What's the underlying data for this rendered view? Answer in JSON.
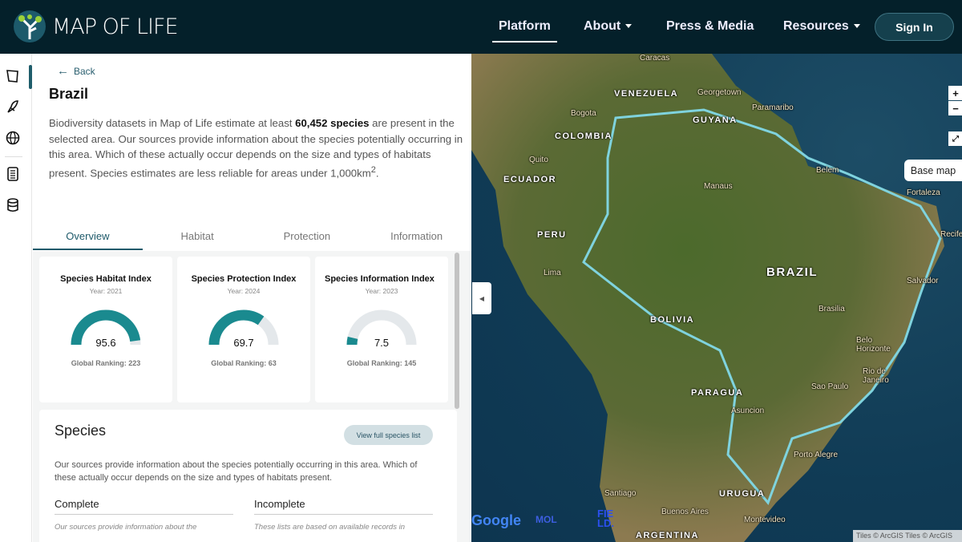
{
  "header": {
    "brand": "MAP OF LIFE",
    "nav": [
      "Platform",
      "About",
      "Press & Media",
      "Resources"
    ],
    "sign_in": "Sign In"
  },
  "panel": {
    "back": "Back",
    "title": "Brazil",
    "desc_1": "Biodiversity datasets in Map of Life estimate at least ",
    "desc_bold": "60,452 species",
    "desc_2": " are present in the selected area. Our sources provide information about the species potentially occurring in this area. Which of these actually occur depends on the size and types of habitats present. Species estimates are less reliable for areas under 1,000km",
    "desc_sup": "2",
    "desc_end": ".",
    "tabs": [
      "Overview",
      "Habitat",
      "Protection",
      "Information"
    ],
    "cards": [
      {
        "title": "Species Habitat Index",
        "year": "Year: 2021",
        "value": 95.6,
        "value_text": "95.6",
        "ranking": "Global Ranking: 223"
      },
      {
        "title": "Species Protection Index",
        "year": "Year: 2024",
        "value": 69.7,
        "value_text": "69.7",
        "ranking": "Global Ranking: 63"
      },
      {
        "title": "Species Information Index",
        "year": "Year: 2023",
        "value": 7.5,
        "value_text": "7.5",
        "ranking": "Global Ranking: 145"
      }
    ],
    "species": {
      "title": "Species",
      "button": "View full species list",
      "desc": "Our sources provide information about the species potentially occurring in this area. Which of these actually occur depends on the size and types of habitats present.",
      "complete": "Complete",
      "complete_sub": "Our sources provide information about the",
      "incomplete": "Incomplete",
      "incomplete_sub": "These lists are based on available records in"
    }
  },
  "map": {
    "labels": [
      "Caracas",
      "VENEZUELA",
      "Georgetown",
      "Paramaribo",
      "Bogota",
      "GUYANA",
      "COLOMBIA",
      "Quito",
      "ECUADOR",
      "Manaus",
      "Belem",
      "Fortaleza",
      "Recife",
      "PERU",
      "Lima",
      "BRAZIL",
      "Salvador",
      "BOLIVIA",
      "Brasilia",
      "Belo Horizonte",
      "Rio de Janeiro",
      "Sao Paulo",
      "PARAGUA",
      "Asuncion",
      "Porto Alegre",
      "Santiago",
      "URUGUA",
      "Buenos Aires",
      "Montevideo",
      "ARGENTINA"
    ],
    "zoom_in": "+",
    "zoom_out": "−",
    "fullscreen": "⤢",
    "base_map": "Base map",
    "collapse": "◀",
    "attribution": "Tiles © ArcGIS Tiles © ArcGIS",
    "google": "Google",
    "mol": "MOL",
    "field": "FIELD."
  },
  "colors": {
    "header": "#04202a",
    "accent": "#1a8a8f",
    "gauge_track": "#e4e8eb",
    "border": "#7fd3de"
  }
}
